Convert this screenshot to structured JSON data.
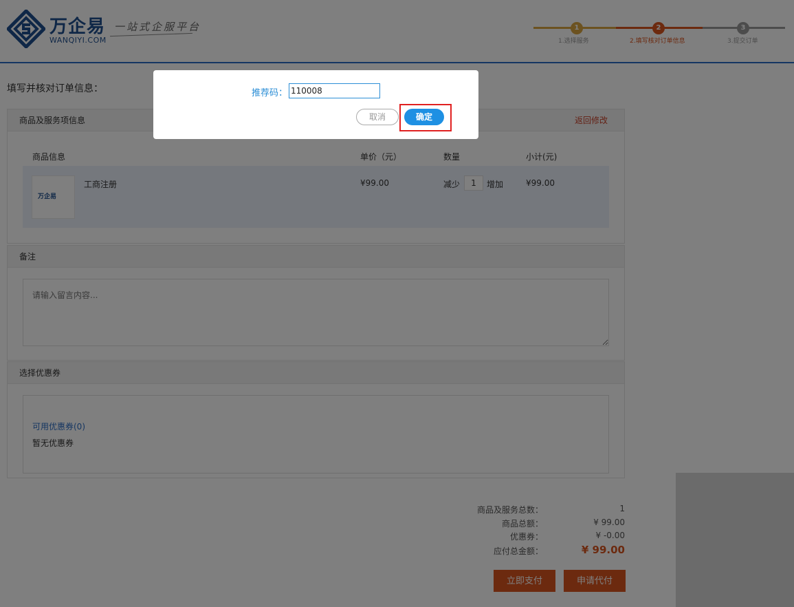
{
  "header": {
    "brand": "万企易",
    "brand_sub": "WANQIYI.COM",
    "slogan": "一站式企服平台",
    "steps": [
      {
        "num": "1",
        "label": "1.选择服务"
      },
      {
        "num": "2",
        "label": "2.填写核对订单信息"
      },
      {
        "num": "3",
        "label": "3.提交订单"
      }
    ]
  },
  "page": {
    "title": "填写并核对订单信息："
  },
  "goods": {
    "title": "商品及服务项信息",
    "back_link": "返回修改",
    "col_info": "商品信息",
    "col_price": "单价（元）",
    "col_qty": "数量",
    "col_subtotal": "小计(元)",
    "item": {
      "thumb_text": "万企易",
      "name": "工商注册",
      "price": "¥99.00",
      "decrease": "减少",
      "qty": "1",
      "increase": "增加",
      "subtotal": "¥99.00"
    }
  },
  "remark": {
    "title": "备注",
    "placeholder": "请输入留言内容..."
  },
  "coupon": {
    "title": "选择优惠券",
    "available": "可用优惠券(0)",
    "none": "暂无优惠券"
  },
  "summary": {
    "count_label": "商品及服务总数：",
    "count_value": "1",
    "amount_label": "商品总额：",
    "amount_value": "¥ 99.00",
    "coupon_label": "优惠券：",
    "coupon_value": "¥ -0.00",
    "total_label": "应付总金额：",
    "total_value": "¥ 99.00"
  },
  "actions": {
    "pay_now": "立即支付",
    "request_proxy": "申请代付"
  },
  "modal": {
    "label": "推荐码：",
    "value": "110008",
    "cancel": "取消",
    "ok": "确定"
  },
  "colors": {
    "brand_blue": "#1f4f8f",
    "accent_orange": "#d9541f",
    "link_blue": "#2b6cc4",
    "ok_blue": "#1e90e3",
    "highlight_red": "#e02020"
  }
}
